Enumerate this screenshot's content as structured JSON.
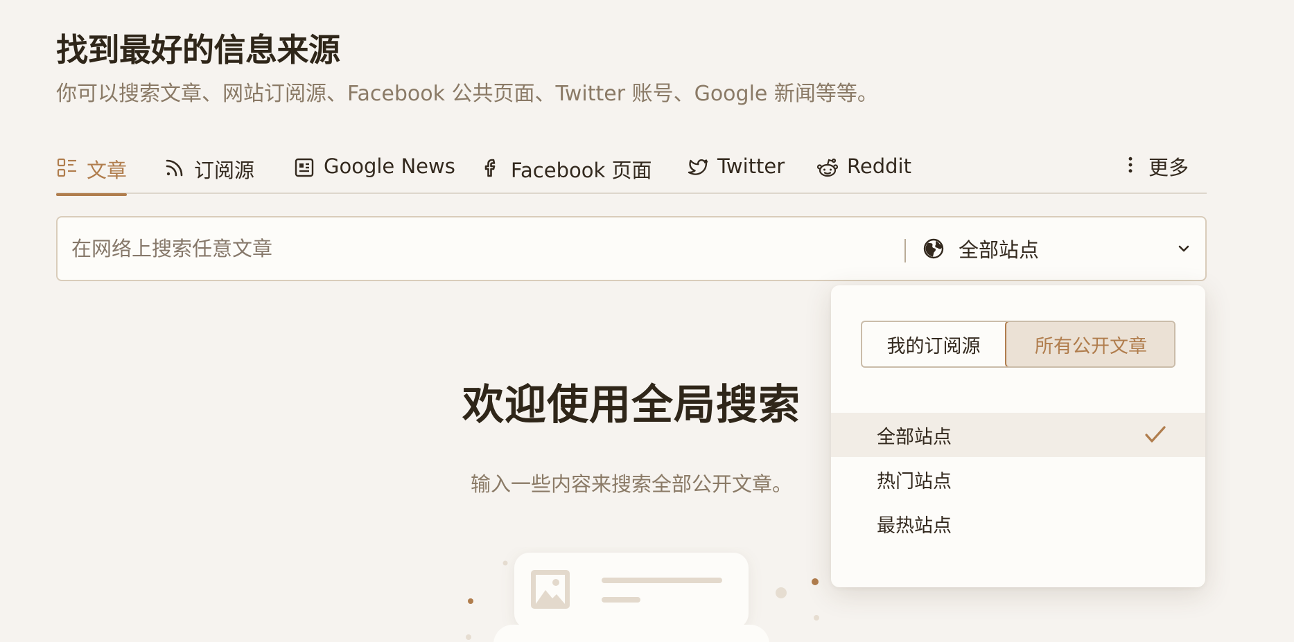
{
  "header": {
    "title": "找到最好的信息来源",
    "subtitle": "你可以搜索文章、网站订阅源、Facebook 公共页面、Twitter 账号、Google 新闻等等。"
  },
  "tabs": [
    {
      "label": "文章",
      "icon": "articles-icon",
      "active": true
    },
    {
      "label": "订阅源",
      "icon": "rss-icon",
      "active": false
    },
    {
      "label": "Google News",
      "icon": "news-icon",
      "active": false
    },
    {
      "label": "Facebook 页面",
      "icon": "facebook-icon",
      "active": false
    },
    {
      "label": "Twitter",
      "icon": "twitter-icon",
      "active": false
    },
    {
      "label": "Reddit",
      "icon": "reddit-icon",
      "active": false
    },
    {
      "label": "更多",
      "icon": "more-vertical-icon",
      "active": false
    }
  ],
  "search": {
    "placeholder": "在网络上搜索任意文章",
    "value": "",
    "scope_label": "全部站点"
  },
  "dropdown": {
    "segments": [
      {
        "label": "我的订阅源",
        "active": false
      },
      {
        "label": "所有公开文章",
        "active": true
      }
    ],
    "options": [
      {
        "label": "全部站点",
        "selected": true
      },
      {
        "label": "热门站点",
        "selected": false
      },
      {
        "label": "最热站点",
        "selected": false
      }
    ]
  },
  "welcome": {
    "title": "欢迎使用全局搜索",
    "text": "输入一些内容来搜索全部公开文章。"
  },
  "colors": {
    "accent": "#b07d4d",
    "background": "#f6f3ef",
    "text": "#33291e",
    "muted_text": "#8a7a66"
  }
}
